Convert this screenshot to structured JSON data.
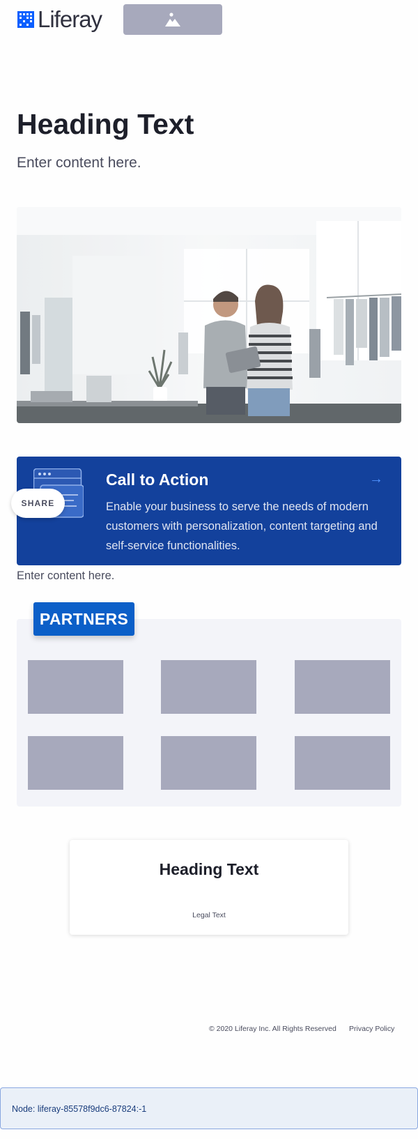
{
  "header": {
    "logo_text": "Liferay",
    "image_button_icon": "image-icon"
  },
  "hero": {
    "title": "Heading Text",
    "subtitle": "Enter content here."
  },
  "photo": {
    "icon": "store-photo"
  },
  "cta": {
    "title": "Call to Action",
    "arrow": "→",
    "body": "Enable your business to serve the needs of modern customers with personalization, content targeting and self-service functionalities.",
    "icon": "browser-window-icon"
  },
  "share": {
    "label": "SHARE"
  },
  "content_text": "Enter content here.",
  "partners": {
    "label": "PARTNERS",
    "logo_count": 6
  },
  "card": {
    "title": "Heading Text",
    "legal": "Legal Text"
  },
  "footer": {
    "copyright": "© 2020 Liferay Inc. All Rights Reserved",
    "privacy": "Privacy Policy"
  },
  "node": {
    "text": "Node: liferay-85578f9dc6-87824:-1"
  },
  "colors": {
    "brand_blue": "#0b5fff",
    "cta_bg": "#13419c",
    "partners_badge": "#0b5fc8",
    "placeholder": "#a7a9bc"
  }
}
